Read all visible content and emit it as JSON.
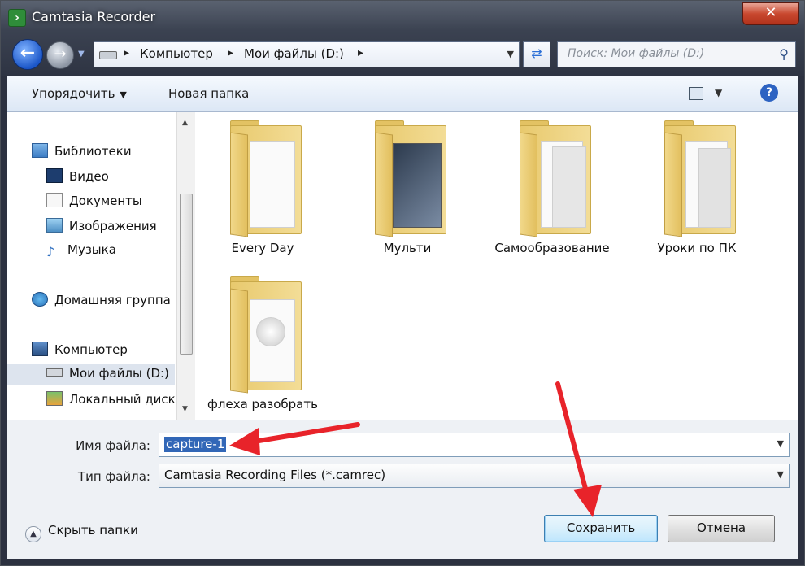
{
  "window": {
    "title": "Camtasia Recorder",
    "close_label": "✕"
  },
  "nav": {
    "back_label": "←",
    "forward_label": "→",
    "breadcrumbs": [
      "Компьютер",
      "Мои файлы (D:)"
    ],
    "search_placeholder": "Поиск: Мои файлы (D:)"
  },
  "toolbar": {
    "organize_label": "Упорядочить",
    "new_folder_label": "Новая папка",
    "help_label": "?"
  },
  "sidebar": {
    "items": [
      {
        "label": "Библиотеки",
        "icon": "libraries-icon"
      },
      {
        "label": "Видео",
        "icon": "video-icon"
      },
      {
        "label": "Документы",
        "icon": "documents-icon"
      },
      {
        "label": "Изображения",
        "icon": "pictures-icon"
      },
      {
        "label": "Музыка",
        "icon": "music-icon"
      },
      {
        "label": "Домашняя группа",
        "icon": "homegroup-icon"
      },
      {
        "label": "Компьютер",
        "icon": "computer-icon"
      },
      {
        "label": "Мои файлы (D:)",
        "icon": "drive-icon",
        "selected": true
      },
      {
        "label": "Локальный диск",
        "icon": "local-disk-icon"
      }
    ]
  },
  "files": [
    {
      "name": "Every Day"
    },
    {
      "name": "Мульти"
    },
    {
      "name": "Самообразование"
    },
    {
      "name": "Уроки по ПК"
    },
    {
      "name": "флеха разобрать"
    }
  ],
  "form": {
    "filename_label": "Имя файла:",
    "filename_value": "capture-1",
    "filetype_label": "Тип файла:",
    "filetype_value": "Camtasia Recording Files (*.camrec)"
  },
  "footer": {
    "hide_folders_label": "Скрыть папки",
    "save_label": "Сохранить",
    "cancel_label": "Отмена"
  },
  "colors": {
    "annotation_arrow": "#e8232a",
    "selection": "#3267b7"
  }
}
